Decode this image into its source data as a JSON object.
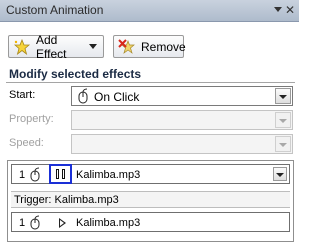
{
  "window": {
    "title": "Custom Animation",
    "close_glyph": "✕"
  },
  "toolbar": {
    "add_effect_label": "Add Effect",
    "add_effect_icon": "star-icon",
    "remove_label": "Remove",
    "remove_icon": "remove-star-icon"
  },
  "modify": {
    "heading": "Modify selected effects",
    "start_label": "Start:",
    "start_value": "On Click",
    "start_icon": "mouse-click-icon",
    "property_label": "Property:",
    "property_value": "",
    "speed_label": "Speed:",
    "speed_value": ""
  },
  "effects_list": {
    "items": [
      {
        "number": "1",
        "icon": "mouse-click-icon",
        "effect_icon": "pause-icon",
        "label": "Kalimba.mp3",
        "selected": true
      }
    ],
    "trigger_label": "Trigger: Kalimba.mp3",
    "trigger_items": [
      {
        "number": "1",
        "icon": "mouse-click-icon",
        "effect_icon": "play-icon",
        "label": "Kalimba.mp3"
      }
    ]
  },
  "colors": {
    "titlebar": "#b8c4d4",
    "selection_outline": "#1a2fd6",
    "disabled_text": "#a0a0a0"
  }
}
